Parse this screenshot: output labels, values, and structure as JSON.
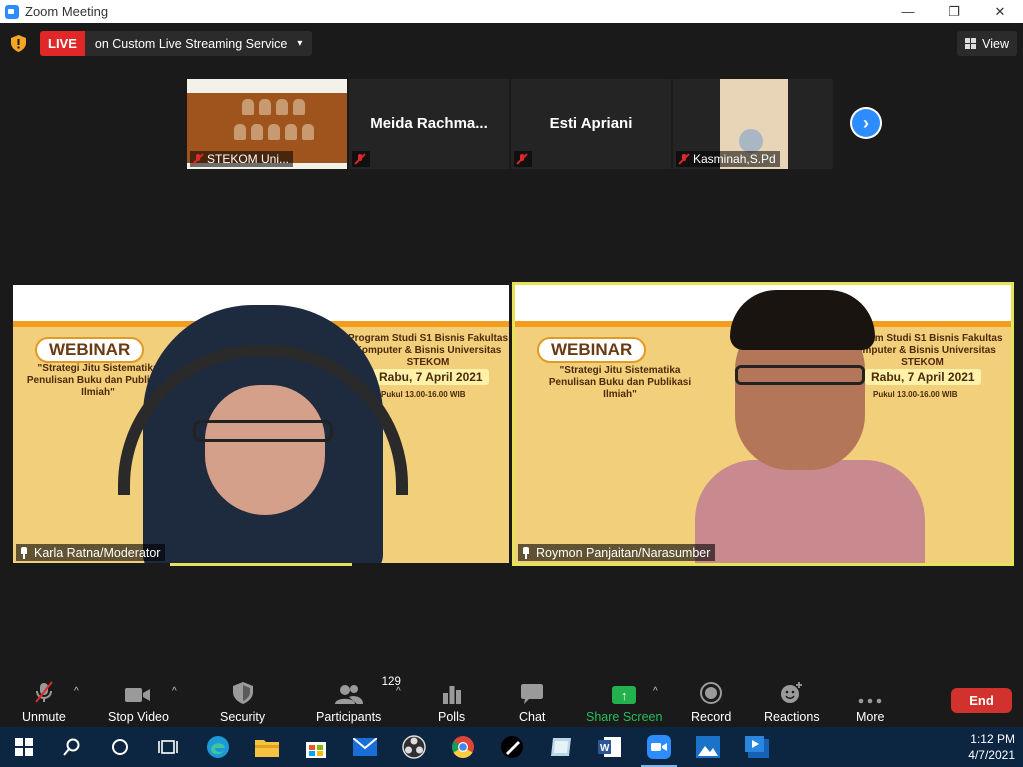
{
  "window": {
    "title": "Zoom Meeting",
    "controls": {
      "minimize": "—",
      "restore": "❐",
      "close": "✕"
    }
  },
  "meeting_bar": {
    "live_badge": "LIVE",
    "live_text": "on Custom Live Streaming Service",
    "live_caret": "▾",
    "view_label": "View"
  },
  "thumbnails": [
    {
      "name": "STEKOM Uni...",
      "muted": true,
      "kind": "poster"
    },
    {
      "name": "Meida  Rachma...",
      "muted": true,
      "kind": "name"
    },
    {
      "name": "Esti Apriani",
      "muted": true,
      "kind": "name"
    },
    {
      "name": "Kasminah,S.Pd",
      "muted": true,
      "kind": "video"
    }
  ],
  "next_arrow": "›",
  "videos": [
    {
      "name": "Karla Ratna/Moderator",
      "webinar": "WEBINAR",
      "topic": "\"Strategi Jitu Sistematika Penulisan Buku dan Publikasi Ilmiah\"",
      "program": "Program Studi S1 Bisnis Fakultas Komputer & Bisnis Universitas STEKOM",
      "date": "Rabu, 7 April 2021",
      "time": "Pukul 13.00-16.00 WIB"
    },
    {
      "name": "Roymon Panjaitan/Narasumber",
      "webinar": "WEBINAR",
      "topic": "\"Strategi Jitu Sistematika Penulisan Buku dan Publikasi Ilmiah\"",
      "program": "Program Studi S1 Bisnis Fakultas Komputer & Bisnis Universitas STEKOM",
      "date": "Rabu, 7 April 2021",
      "time": "Pukul 13.00-16.00 WIB"
    }
  ],
  "toolbar": {
    "unmute": "Unmute",
    "stop_video": "Stop Video",
    "security": "Security",
    "participants": "Participants",
    "participants_count": "129",
    "polls": "Polls",
    "chat": "Chat",
    "share_screen": "Share Screen",
    "record": "Record",
    "reactions": "Reactions",
    "more": "More",
    "end": "End",
    "caret": "^"
  },
  "taskbar": {
    "time": "1:12 PM",
    "date": "4/7/2021"
  },
  "colors": {
    "live_red": "#e02828",
    "zoom_blue": "#2d8cff",
    "active_speaker": "#e6e35a",
    "share_green": "#22b14c",
    "end_red": "#d2322d"
  }
}
